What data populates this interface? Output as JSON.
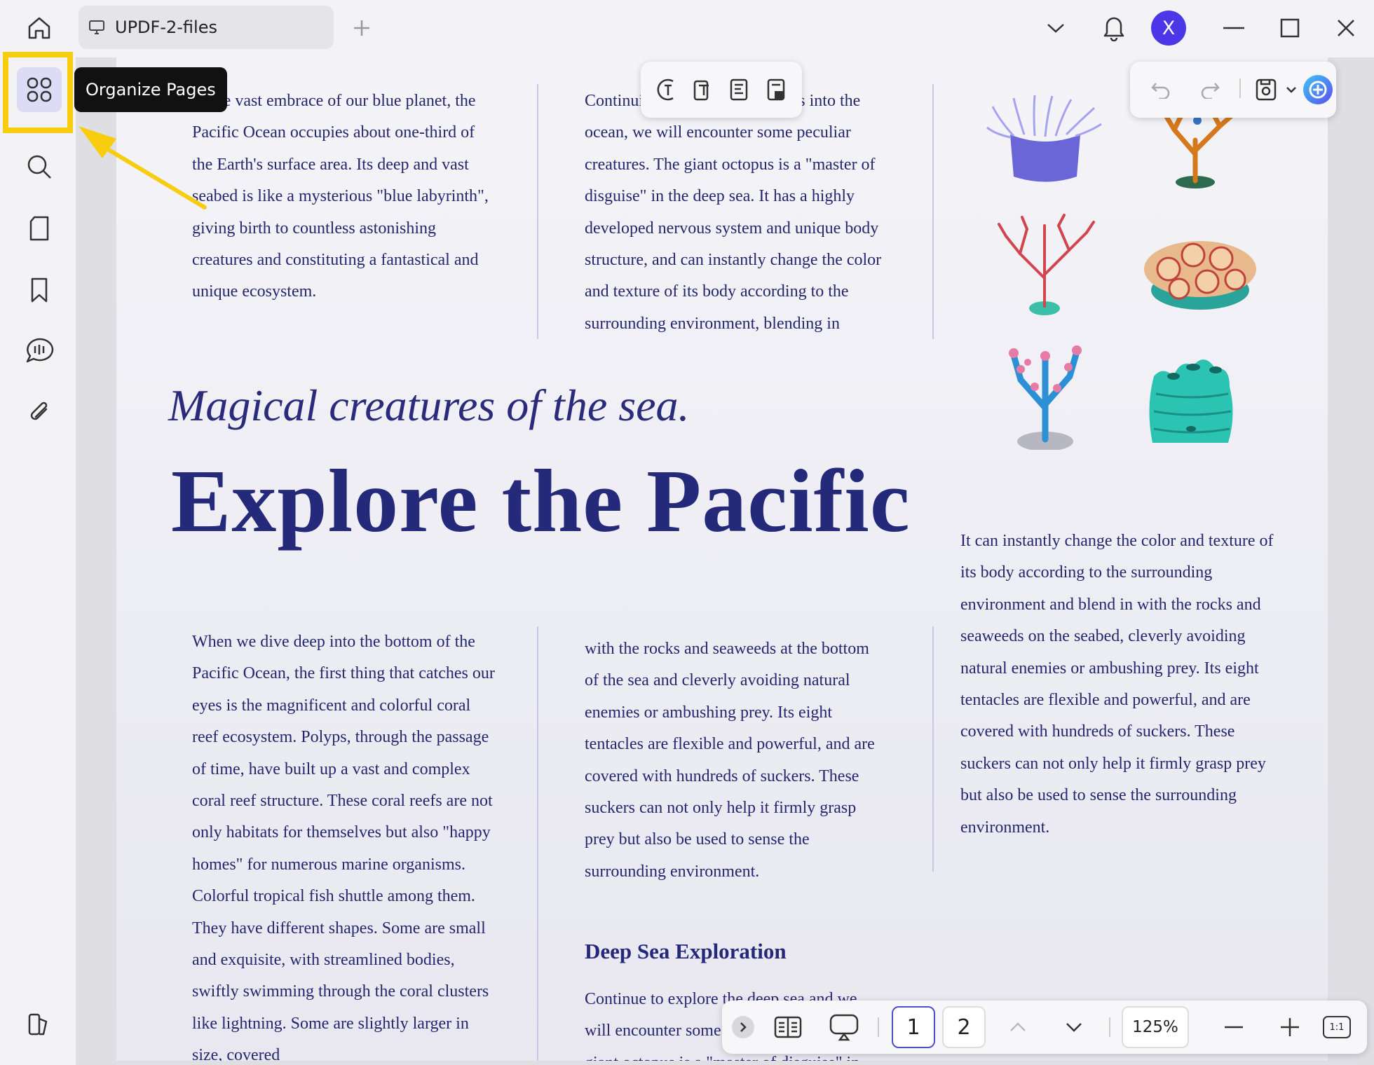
{
  "tab": {
    "title": "UPDF-2-files"
  },
  "user": {
    "avatar_letter": "X"
  },
  "tooltip": {
    "text": "Organize Pages"
  },
  "document": {
    "col1_top": "In the vast embrace of our blue planet, the Pacific Ocean occupies about one-third of the Earth's surface area. Its deep and vast seabed is like a mysterious \"blue labyrinth\", giving birth to countless astonishing creatures and constituting a fantastical and unique ecosystem.",
    "col2_top": "Continuing to explore the depths into the ocean, we will encounter some peculiar creatures. The giant octopus is a \"master of disguise\" in the deep sea. It has a highly developed nervous system and unique body structure, and can instantly change the color and texture of its body according to the surrounding environment, blending in",
    "subtitle": "Magical creatures of the sea.",
    "title": "Explore the Pacific",
    "col3_right": "It can instantly change the color and texture of its body according to the surrounding environment and blend in with the rocks and seaweeds on the seabed, cleverly avoiding natural enemies or ambushing prey. Its eight tentacles are flexible and powerful, and are covered with hundreds of suckers. These suckers can not only help it firmly grasp prey but also be used to sense the surrounding environment.",
    "col1_bottom": "When we dive deep into the bottom of the Pacific Ocean, the first thing that catches our eyes is the magnificent and colorful coral reef ecosystem. Polyps, through the passage of time, have built up a vast and complex coral reef structure. These coral reefs are not only habitats for themselves but also \"happy homes\" for numerous marine organisms. Colorful tropical fish shuttle among them. They have different shapes. Some are small and exquisite, with streamlined bodies, swiftly swimming through the coral clusters like lightning. Some are slightly larger in size, covered",
    "col2_bottom": "with the rocks and seaweeds at the bottom of the sea and cleverly avoiding natural enemies or ambushing prey. Its eight tentacles are flexible and powerful, and are covered with hundreds of suckers. These suckers can not only help it firmly grasp prey but also be used to sense the surrounding environment.",
    "section_heading": "Deep Sea Exploration",
    "section_text": "Continue to explore the deep sea and we will encounter some peculiar creatures. The giant octopus is a \"master of disguise\" in"
  },
  "pagination": {
    "page1": "1",
    "page2": "2",
    "zoom": "125%",
    "fit": "1:1"
  },
  "colors": {
    "highlight": "#f9cd0f",
    "accent": "#4b37e8",
    "text": "#25276e"
  },
  "icons": {
    "titlebar": [
      "home-icon",
      "monitor-icon",
      "plus-icon",
      "chevron-down-icon",
      "bell-icon",
      "minimize-icon",
      "maximize-icon",
      "close-icon"
    ],
    "sidebar": [
      "grid-icon",
      "search-icon",
      "page-icon",
      "bookmark-icon",
      "comment-icon",
      "paperclip-icon",
      "layers-icon"
    ]
  }
}
